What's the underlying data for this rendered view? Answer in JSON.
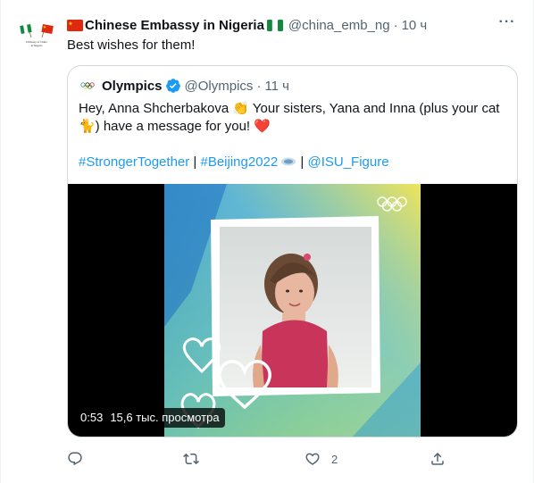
{
  "tweet": {
    "author": "Chinese Embassy in Nigeria",
    "handle": "@china_emb_ng",
    "separator": "·",
    "time": "10 ч",
    "text": "Best wishes for them!",
    "more_label": "···",
    "avatar_caption": "Embassy of China in Nigeria"
  },
  "quoted": {
    "author": "Olympics",
    "handle": "@Olympics",
    "separator": "·",
    "time": "11 ч",
    "line1": "Hey, Anna Shcherbakova 👏 Your sisters, Yana and Inna (plus your cat",
    "line2": "🐈) have a message for you! ❤️",
    "hashtags": {
      "tag1": "#StrongerTogether",
      "sep1": " | ",
      "tag2": "#Beijing2022",
      "sep2": " | ",
      "mention": "@ISU_Figure"
    }
  },
  "media": {
    "duration": "0:53",
    "views": "15,6 тыс. просмотра"
  },
  "actions": {
    "reply_count": "",
    "retweet_count": "",
    "like_count": "2",
    "share_count": ""
  },
  "icons": {
    "reply": "reply-icon",
    "retweet": "retweet-icon",
    "like": "heart-icon",
    "share": "share-icon",
    "verified": "verified-badge-icon",
    "olympic": "olympic-rings-icon"
  },
  "colors": {
    "text": "#0f1419",
    "secondary": "#536471",
    "link": "#1d9bf0",
    "verified": "#1d9bf0",
    "border": "#cfd9de"
  }
}
